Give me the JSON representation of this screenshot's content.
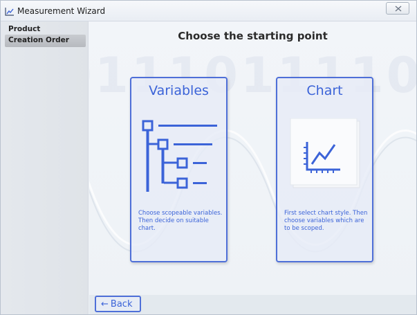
{
  "window": {
    "title": "Measurement Wizard"
  },
  "sidebar": {
    "items": [
      {
        "label": "Product",
        "selected": false
      },
      {
        "label": "Creation Order",
        "selected": true
      }
    ]
  },
  "main": {
    "heading": "Choose the starting point",
    "background_digits": "10011101111010101",
    "cards": [
      {
        "title": "Variables",
        "icon": "variables-tree-icon",
        "description": "Choose scopeable variables. Then decide on suitable chart."
      },
      {
        "title": "Chart",
        "icon": "chart-icon",
        "description": "First select chart style. Then choose variables which are to be scoped."
      }
    ]
  },
  "footer": {
    "back_arrow": "←",
    "back_label": "Back"
  },
  "colors": {
    "accent": "#3b63d8",
    "card_border": "#4e6fd8",
    "selected_nav": "#bcc0c5"
  }
}
